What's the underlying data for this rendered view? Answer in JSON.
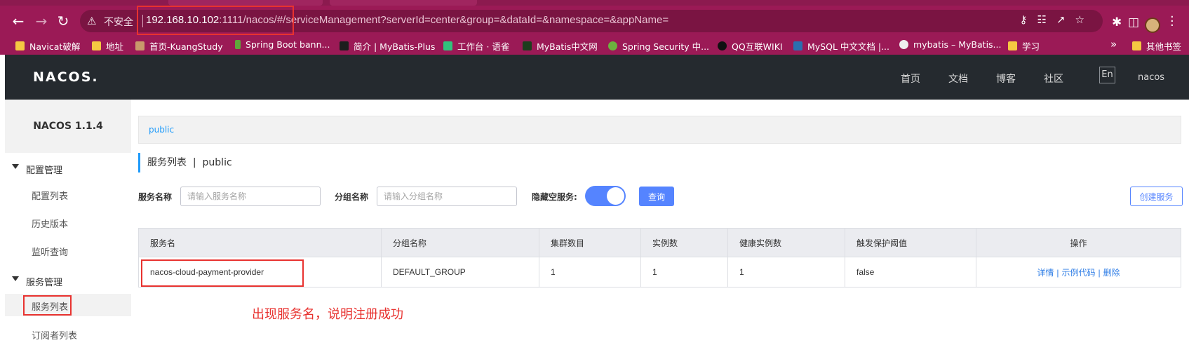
{
  "browser": {
    "insecure_label": "不安全",
    "url_host": "192.168.10.102",
    "url_rest": ":1111/nacos/#/serviceManagement?serverId=center&group=&dataId=&namespace=&appName=",
    "bookmarks": [
      {
        "label": "Navicat破解",
        "icon": "folder-icon"
      },
      {
        "label": "地址",
        "icon": "folder-icon"
      },
      {
        "label": "首页-KuangStudy",
        "icon": "site-icon"
      },
      {
        "label": "Spring Boot bann...",
        "icon": "site-icon"
      },
      {
        "label": "简介 | MyBatis-Plus",
        "icon": "site-icon"
      },
      {
        "label": "工作台 · 语雀",
        "icon": "site-icon"
      },
      {
        "label": "MyBatis中文网",
        "icon": "site-icon"
      },
      {
        "label": "Spring Security 中...",
        "icon": "site-icon"
      },
      {
        "label": "QQ互联WIKI",
        "icon": "site-icon"
      },
      {
        "label": "MySQL 中文文档 |...",
        "icon": "site-icon"
      },
      {
        "label": "mybatis – MyBatis...",
        "icon": "site-icon"
      },
      {
        "label": "学习",
        "icon": "folder-icon"
      }
    ],
    "bookmarks_more": "»",
    "other_bookmarks": "其他书签"
  },
  "header": {
    "logo": "NACOS.",
    "nav": [
      "首页",
      "文档",
      "博客",
      "社区"
    ],
    "lang": "En",
    "user": "nacos"
  },
  "sidebar": {
    "version": "NACOS 1.1.4",
    "groups": [
      {
        "label": "配置管理",
        "items": [
          "配置列表",
          "历史版本",
          "监听查询"
        ]
      },
      {
        "label": "服务管理",
        "items": [
          "服务列表",
          "订阅者列表"
        ]
      }
    ]
  },
  "main": {
    "breadcrumb": "public",
    "title": "服务列表",
    "title_sep": "|",
    "namespace": "public",
    "filters": {
      "service_name_label": "服务名称",
      "service_name_placeholder": "请输入服务名称",
      "group_name_label": "分组名称",
      "group_name_placeholder": "请输入分组名称",
      "hide_empty_label": "隐藏空服务:",
      "hide_empty_on": true,
      "query_button": "查询",
      "create_button": "创建服务"
    },
    "table": {
      "headers": [
        "服务名",
        "分组名称",
        "集群数目",
        "实例数",
        "健康实例数",
        "触发保护阈值",
        "操作"
      ],
      "rows": [
        {
          "service_name": "nacos-cloud-payment-provider",
          "group": "DEFAULT_GROUP",
          "clusters": "1",
          "instances": "1",
          "healthy_instances": "1",
          "protect_threshold": "false",
          "ops": [
            "详情",
            "示例代码",
            "删除"
          ]
        }
      ]
    },
    "annotation": "出现服务名，说明注册成功"
  },
  "colors": {
    "accent": "#5584ff",
    "browser": "#9b1a56",
    "header": "#252a2f",
    "highlight": "#e8322f"
  }
}
